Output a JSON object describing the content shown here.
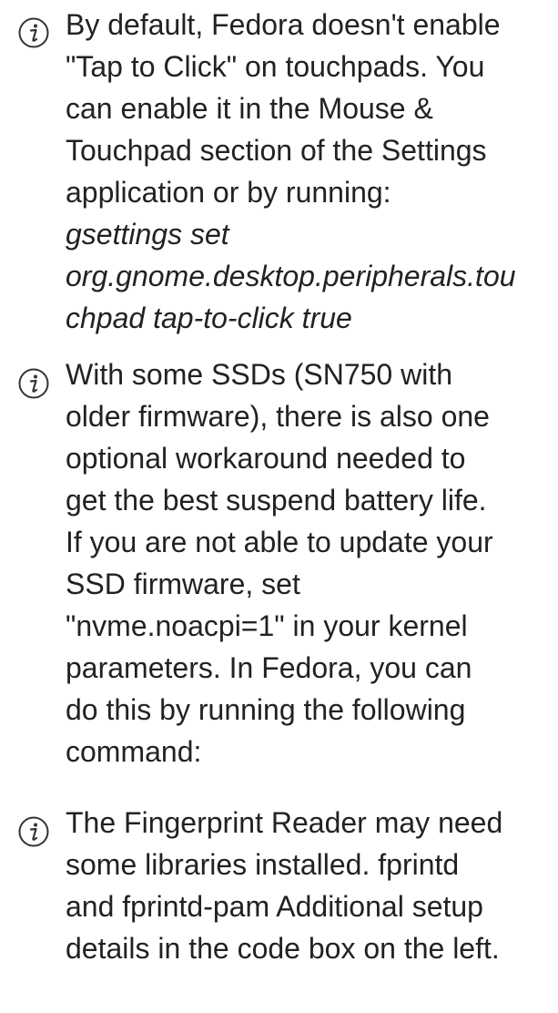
{
  "notes": [
    {
      "icon": "info-icon",
      "text_lines": [
        "By default, Fedora doesn't enable",
        "\"Tap to Click\" on touchpads. You",
        "can enable it in the Mouse &",
        "Touchpad section of the Settings",
        "application or by running:"
      ],
      "command_lines": [
        "gsettings set",
        "org.gnome.desktop.peripherals.tou",
        "chpad tap-to-click true"
      ]
    },
    {
      "icon": "info-icon",
      "text_lines": [
        "With some SSDs (SN750 with",
        "older firmware), there is also one",
        "optional workaround needed to",
        "get the best suspend battery life.",
        "If you are not able to update your",
        "SSD firmware, set",
        "\"nvme.noacpi=1\" in your kernel",
        "parameters. In Fedora, you can",
        "do this by running the following",
        "command:"
      ]
    },
    {
      "icon": "info-icon",
      "text_lines": [
        "The Fingerprint Reader may need",
        "some libraries installed. fprintd",
        "and fprintd-pam Additional setup",
        "details in the code box on the left."
      ]
    }
  ],
  "colors": {
    "text": "#222222",
    "icon_stroke": "#333333"
  }
}
